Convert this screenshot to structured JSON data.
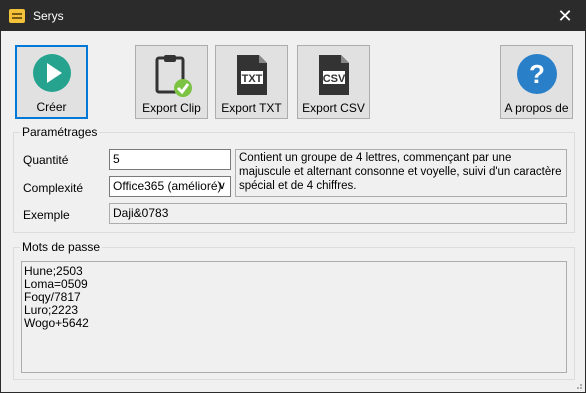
{
  "window": {
    "title": "Serys",
    "close_glyph": "✕"
  },
  "toolbar": {
    "create_label": "Créer",
    "export_clip_label": "Export Clip",
    "export_txt_label": "Export TXT",
    "export_csv_label": "Export CSV",
    "about_label": "A propos de",
    "txt_icon_text": "TXT",
    "csv_icon_text": "CSV",
    "help_icon_text": "?"
  },
  "settings": {
    "group_title": "Paramétrages",
    "quantity_label": "Quantité",
    "quantity_value": "5",
    "complexity_label": "Complexité",
    "complexity_value": "Office365 (amélioré)",
    "example_label": "Exemple",
    "example_value": "Daji&0783",
    "description": "Contient un groupe de 4 lettres, commençant par une majuscule et alternant consonne et voyelle, suivi d'un caractère spécial et de 4 chiffres."
  },
  "passwords": {
    "group_title": "Mots de passe",
    "items": [
      "Hune;2503",
      "Loma=0509",
      "Foqy/7817",
      "Luro;2223",
      "Wogo+5642"
    ]
  },
  "colors": {
    "accent": "#0078d7",
    "create_icon": "#26a38f",
    "check": "#7cc243",
    "help": "#2a7fc9"
  }
}
